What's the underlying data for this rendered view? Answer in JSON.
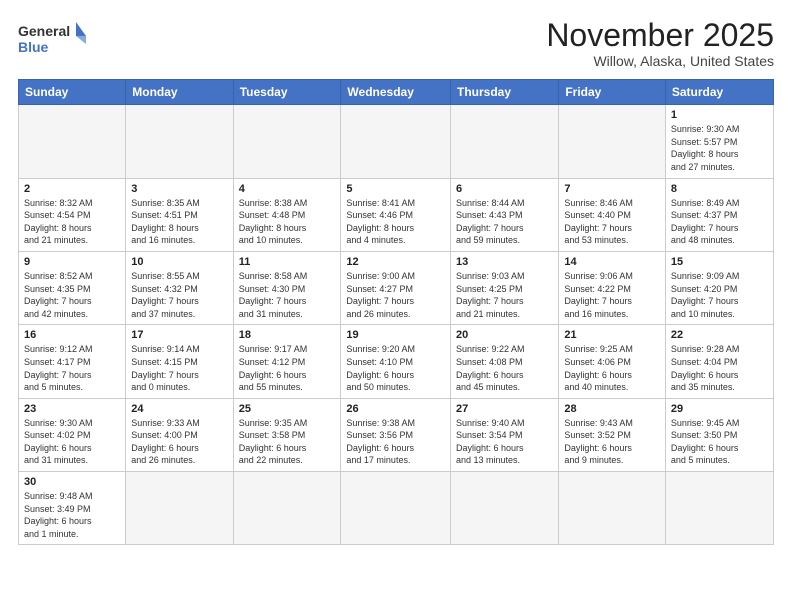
{
  "header": {
    "logo_general": "General",
    "logo_blue": "Blue",
    "month_title": "November 2025",
    "location": "Willow, Alaska, United States"
  },
  "weekdays": [
    "Sunday",
    "Monday",
    "Tuesday",
    "Wednesday",
    "Thursday",
    "Friday",
    "Saturday"
  ],
  "weeks": [
    [
      {
        "day": "",
        "info": ""
      },
      {
        "day": "",
        "info": ""
      },
      {
        "day": "",
        "info": ""
      },
      {
        "day": "",
        "info": ""
      },
      {
        "day": "",
        "info": ""
      },
      {
        "day": "",
        "info": ""
      },
      {
        "day": "1",
        "info": "Sunrise: 9:30 AM\nSunset: 5:57 PM\nDaylight: 8 hours\nand 27 minutes."
      }
    ],
    [
      {
        "day": "2",
        "info": "Sunrise: 8:32 AM\nSunset: 4:54 PM\nDaylight: 8 hours\nand 21 minutes."
      },
      {
        "day": "3",
        "info": "Sunrise: 8:35 AM\nSunset: 4:51 PM\nDaylight: 8 hours\nand 16 minutes."
      },
      {
        "day": "4",
        "info": "Sunrise: 8:38 AM\nSunset: 4:48 PM\nDaylight: 8 hours\nand 10 minutes."
      },
      {
        "day": "5",
        "info": "Sunrise: 8:41 AM\nSunset: 4:46 PM\nDaylight: 8 hours\nand 4 minutes."
      },
      {
        "day": "6",
        "info": "Sunrise: 8:44 AM\nSunset: 4:43 PM\nDaylight: 7 hours\nand 59 minutes."
      },
      {
        "day": "7",
        "info": "Sunrise: 8:46 AM\nSunset: 4:40 PM\nDaylight: 7 hours\nand 53 minutes."
      },
      {
        "day": "8",
        "info": "Sunrise: 8:49 AM\nSunset: 4:37 PM\nDaylight: 7 hours\nand 48 minutes."
      }
    ],
    [
      {
        "day": "9",
        "info": "Sunrise: 8:52 AM\nSunset: 4:35 PM\nDaylight: 7 hours\nand 42 minutes."
      },
      {
        "day": "10",
        "info": "Sunrise: 8:55 AM\nSunset: 4:32 PM\nDaylight: 7 hours\nand 37 minutes."
      },
      {
        "day": "11",
        "info": "Sunrise: 8:58 AM\nSunset: 4:30 PM\nDaylight: 7 hours\nand 31 minutes."
      },
      {
        "day": "12",
        "info": "Sunrise: 9:00 AM\nSunset: 4:27 PM\nDaylight: 7 hours\nand 26 minutes."
      },
      {
        "day": "13",
        "info": "Sunrise: 9:03 AM\nSunset: 4:25 PM\nDaylight: 7 hours\nand 21 minutes."
      },
      {
        "day": "14",
        "info": "Sunrise: 9:06 AM\nSunset: 4:22 PM\nDaylight: 7 hours\nand 16 minutes."
      },
      {
        "day": "15",
        "info": "Sunrise: 9:09 AM\nSunset: 4:20 PM\nDaylight: 7 hours\nand 10 minutes."
      }
    ],
    [
      {
        "day": "16",
        "info": "Sunrise: 9:12 AM\nSunset: 4:17 PM\nDaylight: 7 hours\nand 5 minutes."
      },
      {
        "day": "17",
        "info": "Sunrise: 9:14 AM\nSunset: 4:15 PM\nDaylight: 7 hours\nand 0 minutes."
      },
      {
        "day": "18",
        "info": "Sunrise: 9:17 AM\nSunset: 4:12 PM\nDaylight: 6 hours\nand 55 minutes."
      },
      {
        "day": "19",
        "info": "Sunrise: 9:20 AM\nSunset: 4:10 PM\nDaylight: 6 hours\nand 50 minutes."
      },
      {
        "day": "20",
        "info": "Sunrise: 9:22 AM\nSunset: 4:08 PM\nDaylight: 6 hours\nand 45 minutes."
      },
      {
        "day": "21",
        "info": "Sunrise: 9:25 AM\nSunset: 4:06 PM\nDaylight: 6 hours\nand 40 minutes."
      },
      {
        "day": "22",
        "info": "Sunrise: 9:28 AM\nSunset: 4:04 PM\nDaylight: 6 hours\nand 35 minutes."
      }
    ],
    [
      {
        "day": "23",
        "info": "Sunrise: 9:30 AM\nSunset: 4:02 PM\nDaylight: 6 hours\nand 31 minutes."
      },
      {
        "day": "24",
        "info": "Sunrise: 9:33 AM\nSunset: 4:00 PM\nDaylight: 6 hours\nand 26 minutes."
      },
      {
        "day": "25",
        "info": "Sunrise: 9:35 AM\nSunset: 3:58 PM\nDaylight: 6 hours\nand 22 minutes."
      },
      {
        "day": "26",
        "info": "Sunrise: 9:38 AM\nSunset: 3:56 PM\nDaylight: 6 hours\nand 17 minutes."
      },
      {
        "day": "27",
        "info": "Sunrise: 9:40 AM\nSunset: 3:54 PM\nDaylight: 6 hours\nand 13 minutes."
      },
      {
        "day": "28",
        "info": "Sunrise: 9:43 AM\nSunset: 3:52 PM\nDaylight: 6 hours\nand 9 minutes."
      },
      {
        "day": "29",
        "info": "Sunrise: 9:45 AM\nSunset: 3:50 PM\nDaylight: 6 hours\nand 5 minutes."
      }
    ],
    [
      {
        "day": "30",
        "info": "Sunrise: 9:48 AM\nSunset: 3:49 PM\nDaylight: 6 hours\nand 1 minute."
      },
      {
        "day": "",
        "info": ""
      },
      {
        "day": "",
        "info": ""
      },
      {
        "day": "",
        "info": ""
      },
      {
        "day": "",
        "info": ""
      },
      {
        "day": "",
        "info": ""
      },
      {
        "day": "",
        "info": ""
      }
    ]
  ]
}
